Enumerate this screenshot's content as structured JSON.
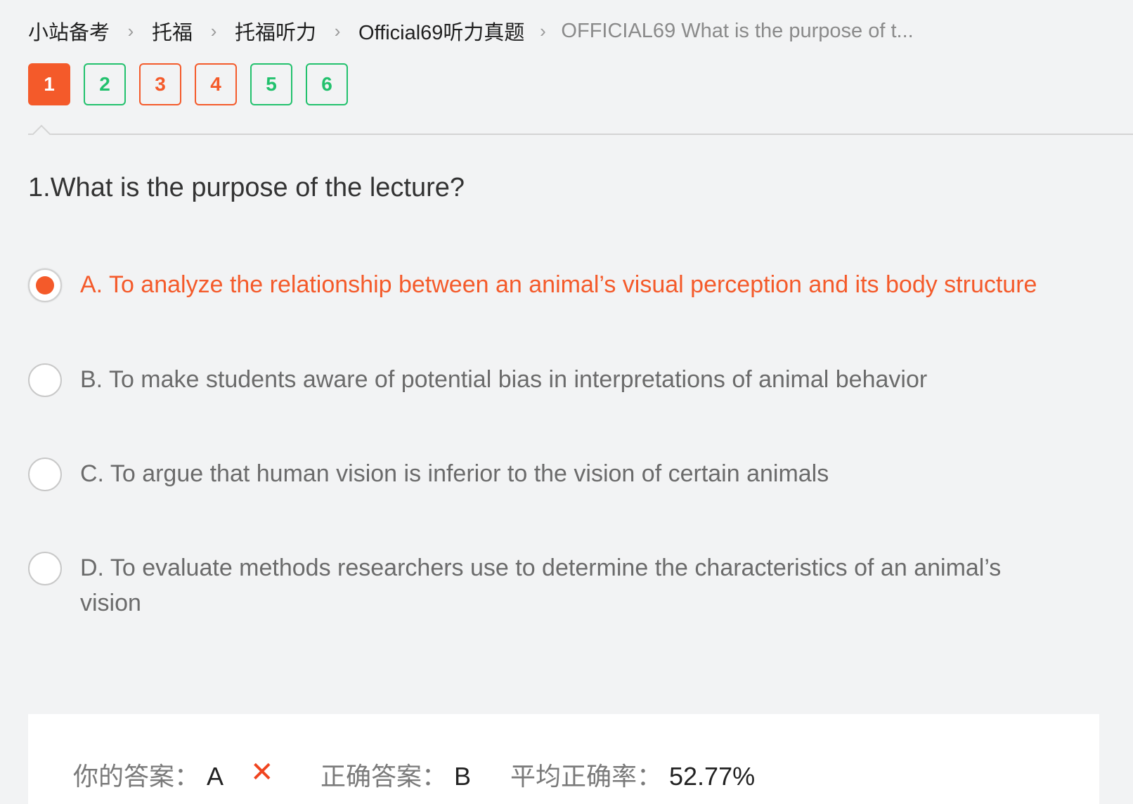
{
  "breadcrumb": {
    "items": [
      "小站备考",
      "托福",
      "托福听力",
      "Official69听力真题"
    ],
    "current": "OFFICIAL69 What is the purpose of t...",
    "separator": ">"
  },
  "question_nav": {
    "items": [
      {
        "label": "1",
        "state": "current"
      },
      {
        "label": "2",
        "state": "correct"
      },
      {
        "label": "3",
        "state": "incorrect"
      },
      {
        "label": "4",
        "state": "incorrect"
      },
      {
        "label": "5",
        "state": "correct"
      },
      {
        "label": "6",
        "state": "correct"
      }
    ]
  },
  "question": {
    "text": "1.What is the purpose of the lecture?"
  },
  "options": [
    {
      "text": "A. To analyze the relationship between an animal’s visual perception and its body structure",
      "selected": true
    },
    {
      "text": "B. To make students aware of potential bias in interpretations of animal behavior",
      "selected": false
    },
    {
      "text": "C. To argue that human vision is inferior to the vision of certain animals",
      "selected": false
    },
    {
      "text": "D. To evaluate methods researchers use to determine the characteristics of an animal’s vision",
      "selected": false
    }
  ],
  "result": {
    "your_answer_label": "你的答案：",
    "your_answer_value": "A",
    "wrong_mark": "✕",
    "correct_answer_label": "正确答案：",
    "correct_answer_value": "B",
    "avg_rate_label": "平均正确率：",
    "avg_rate_value": "52.77%"
  },
  "colors": {
    "accent": "#f45a2a",
    "correct": "#22c16d",
    "background": "#f2f3f4"
  }
}
